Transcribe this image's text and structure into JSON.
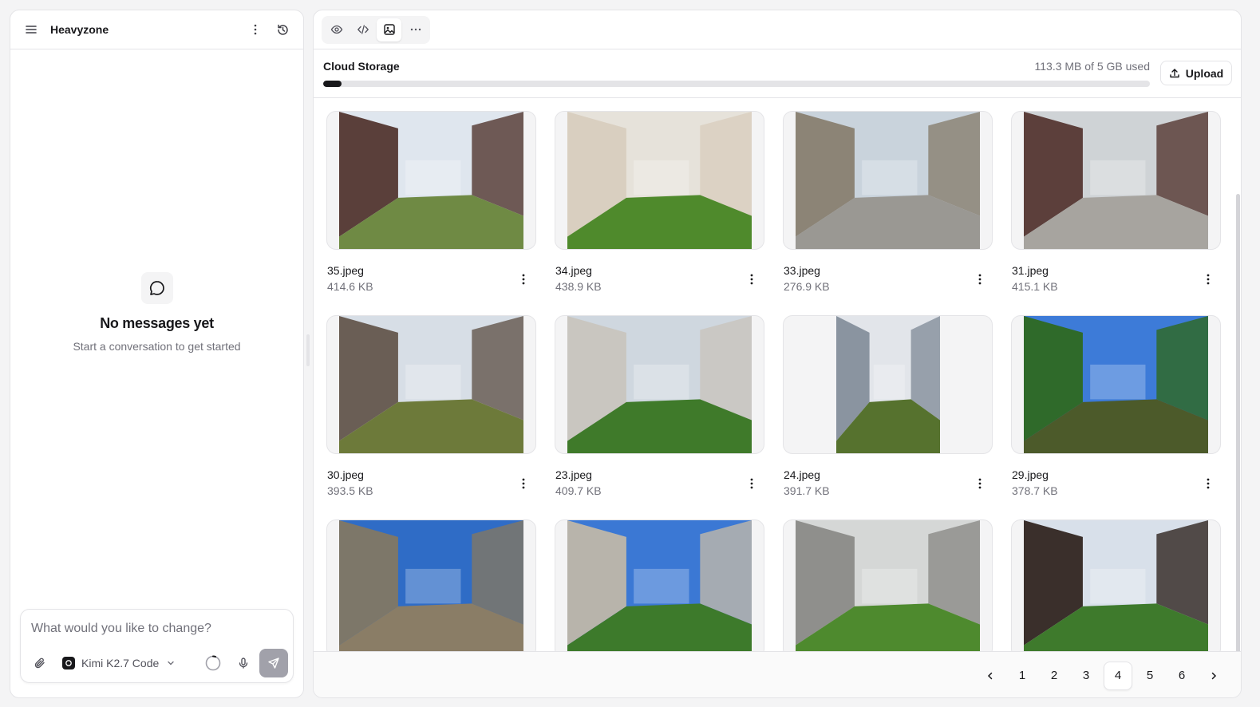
{
  "sidebar": {
    "title": "Heavyzone",
    "empty_title": "No messages yet",
    "empty_subtitle": "Start a conversation to get started",
    "composer_placeholder": "What would you like to change?",
    "model_name": "Kimi K2.7 Code"
  },
  "toolbar": {
    "tabs": [
      {
        "icon": "eye-icon",
        "active": false
      },
      {
        "icon": "code-icon",
        "active": false
      },
      {
        "icon": "image-icon",
        "active": true
      },
      {
        "icon": "more-horizontal-icon",
        "active": false
      }
    ]
  },
  "storage": {
    "label": "Cloud Storage",
    "used_text": "113.3 MB of 5 GB used",
    "used_fraction": 0.0221,
    "upload_label": "Upload"
  },
  "files": [
    {
      "name": "35.jpeg",
      "size": "414.6 KB"
    },
    {
      "name": "34.jpeg",
      "size": "438.9 KB"
    },
    {
      "name": "33.jpeg",
      "size": "276.9 KB"
    },
    {
      "name": "31.jpeg",
      "size": "415.1 KB"
    },
    {
      "name": "30.jpeg",
      "size": "393.5 KB"
    },
    {
      "name": "23.jpeg",
      "size": "409.7 KB"
    },
    {
      "name": "24.jpeg",
      "size": "391.7 KB"
    },
    {
      "name": "29.jpeg",
      "size": "378.7 KB"
    },
    {
      "name": "",
      "size": ""
    },
    {
      "name": "",
      "size": ""
    },
    {
      "name": "",
      "size": ""
    },
    {
      "name": "",
      "size": ""
    }
  ],
  "pagination": {
    "pages": [
      "1",
      "2",
      "3",
      "4",
      "5",
      "6"
    ],
    "current": "4"
  },
  "colors": {
    "accent": "#18181b",
    "muted": "#71717a",
    "border": "#e4e4e7"
  }
}
